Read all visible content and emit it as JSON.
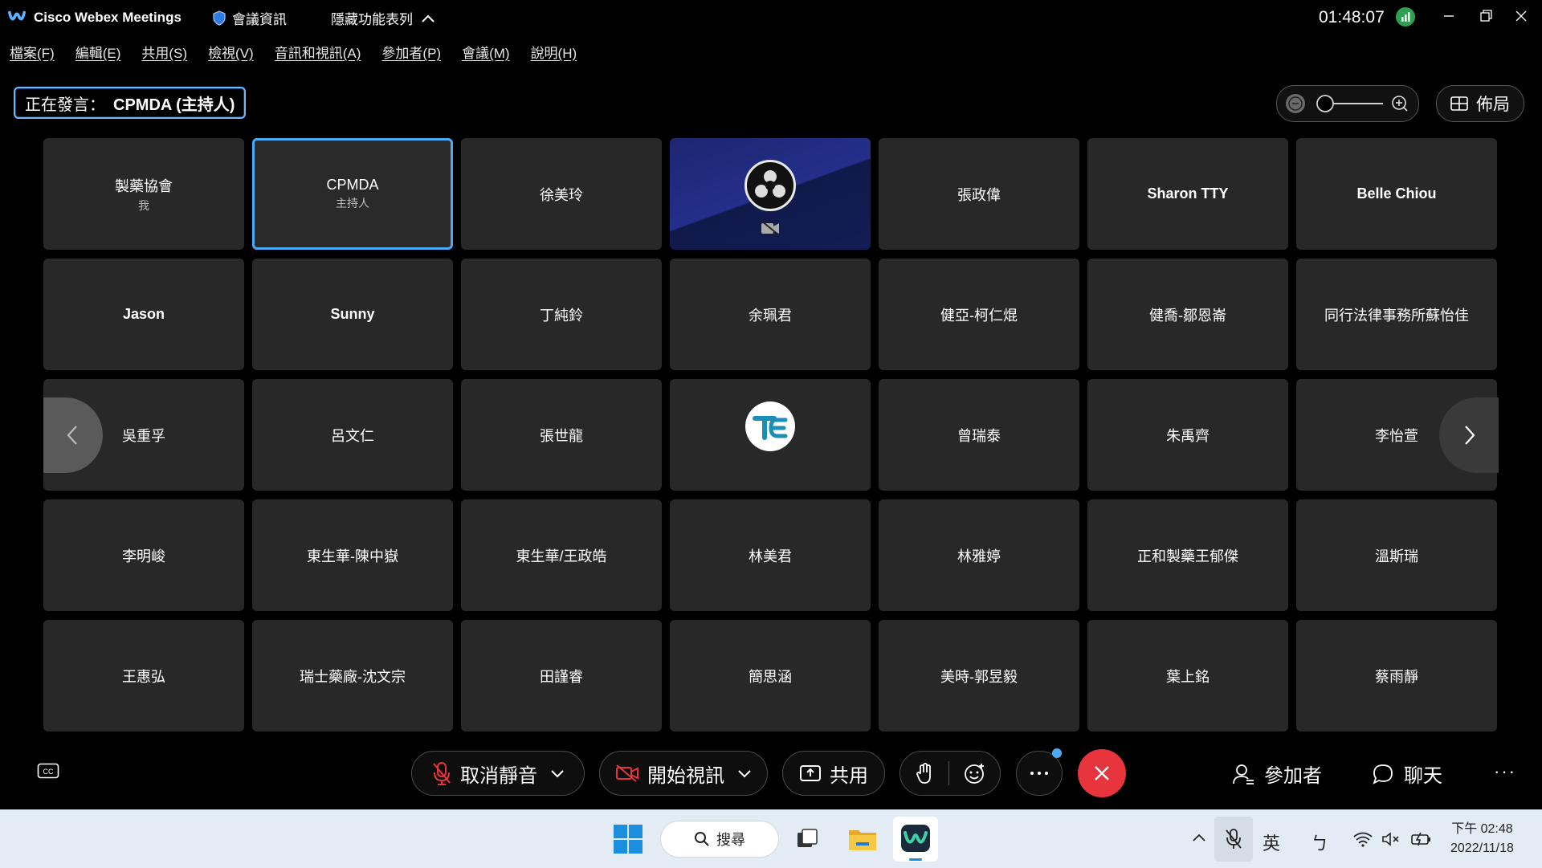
{
  "titlebar": {
    "app_title": "Cisco Webex Meetings",
    "meeting_info": "會議資訊",
    "hide_menu": "隱藏功能表列",
    "clock": "01:48:07"
  },
  "menu": [
    "檔案(F)",
    "編輯(E)",
    "共用(S)",
    "檢視(V)",
    "音訊和視訊(A)",
    "參加者(P)",
    "會議(M)",
    "說明(H)"
  ],
  "speaking": {
    "label": "正在發言：",
    "name": "CPMDA (主持人)"
  },
  "layout_label": "佈局",
  "participants": [
    {
      "name": "製藥協會",
      "sub": "我"
    },
    {
      "name": "CPMDA",
      "sub": "主持人"
    },
    {
      "name": "徐美玲"
    },
    {
      "name": ""
    },
    {
      "name": "張政偉"
    },
    {
      "name": "Sharon TTY"
    },
    {
      "name": "Belle Chiou"
    },
    {
      "name": "Jason"
    },
    {
      "name": "Sunny"
    },
    {
      "name": "丁純鈴"
    },
    {
      "name": "余珮君"
    },
    {
      "name": "健亞-柯仁焜"
    },
    {
      "name": "健喬-鄒恩崙"
    },
    {
      "name": "同行法律事務所蘇怡佳"
    },
    {
      "name": "吳重孚"
    },
    {
      "name": "呂文仁"
    },
    {
      "name": "張世龍"
    },
    {
      "name": ""
    },
    {
      "name": "曾瑞泰"
    },
    {
      "name": "朱禹齊"
    },
    {
      "name": "李怡萱"
    },
    {
      "name": "李明峻"
    },
    {
      "name": "東生華-陳中嶽"
    },
    {
      "name": "東生華/王政皓"
    },
    {
      "name": "林美君"
    },
    {
      "name": "林雅婷"
    },
    {
      "name": "正和製藥王郁傑"
    },
    {
      "name": "溫斯瑞"
    },
    {
      "name": "王惠弘"
    },
    {
      "name": "瑞士藥廠-沈文宗"
    },
    {
      "name": "田謹睿"
    },
    {
      "name": "簡思涵"
    },
    {
      "name": "美時-郭昱毅"
    },
    {
      "name": "葉上銘"
    },
    {
      "name": "蔡雨靜"
    }
  ],
  "controls": {
    "unmute": "取消靜音",
    "start_video": "開始視訊",
    "share": "共用",
    "participants": "參加者",
    "chat": "聊天"
  },
  "taskbar": {
    "search": "搜尋",
    "ime_lang": "英",
    "ime_mode": "ㄅ",
    "time": "下午 02:48",
    "date": "2022/11/18"
  },
  "colors": {
    "accent": "#4ea9f5",
    "leave": "#e8353d",
    "tile": "#282828"
  }
}
